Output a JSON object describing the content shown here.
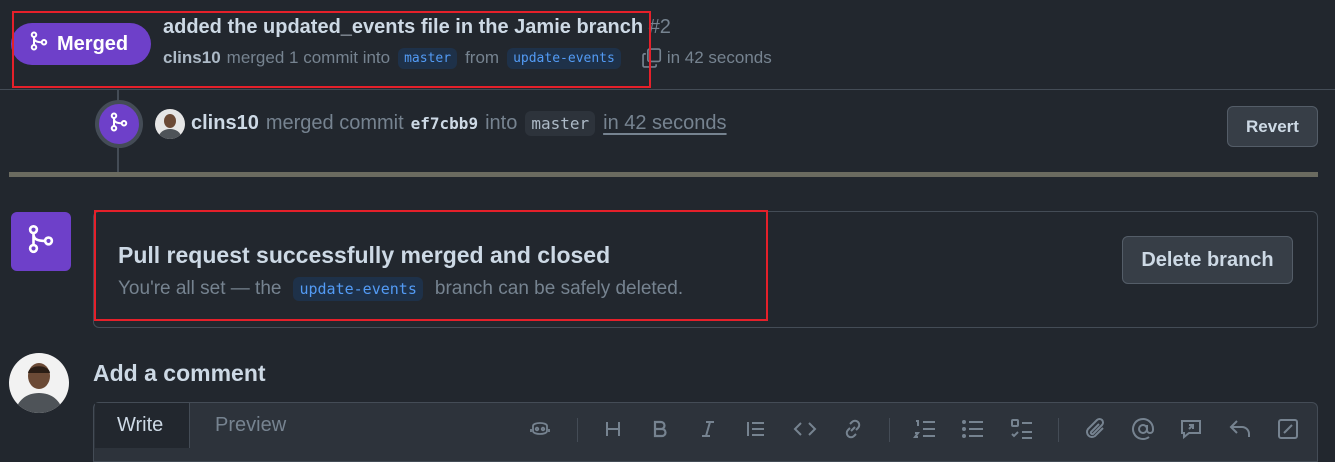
{
  "header": {
    "state_label": "Merged",
    "title": "added the updated_events file in the Jamie branch",
    "number": "#2",
    "author": "clins10",
    "merged_text": "merged 1 commit into",
    "base_branch": "master",
    "from_text": "from",
    "head_branch": "update-events",
    "time": "in 42 seconds"
  },
  "event": {
    "author": "clins10",
    "action": "merged commit",
    "sha": "ef7cbb9",
    "into": "into",
    "branch": "master",
    "time": "in 42 seconds",
    "revert_label": "Revert"
  },
  "merge_box": {
    "title": "Pull request successfully merged and closed",
    "desc_before": "You're all set — the",
    "branch": "update-events",
    "desc_after": "branch can be safely deleted.",
    "delete_label": "Delete branch"
  },
  "comment": {
    "heading": "Add a comment",
    "tabs": {
      "write": "Write",
      "preview": "Preview"
    },
    "toolbar": [
      "copilot-icon",
      "heading-icon",
      "bold-icon",
      "italic-icon",
      "quote-icon",
      "code-icon",
      "link-icon",
      "numbered-list-icon",
      "bullet-list-icon",
      "task-list-icon",
      "attach-icon",
      "mention-icon",
      "reference-icon",
      "undo-icon",
      "fullscreen-icon"
    ]
  },
  "colors": {
    "merged_purple": "#6e40c9",
    "highlight_red": "#e5202a",
    "link_blue": "#539bf5",
    "background": "#22272e"
  }
}
